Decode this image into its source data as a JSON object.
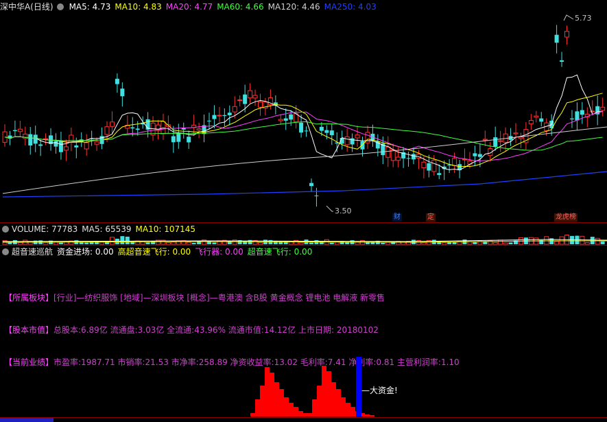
{
  "header": {
    "title": "深中华A(日线)",
    "ma": [
      {
        "label": "MA5: 4.73",
        "color": "#ffffff"
      },
      {
        "label": "MA10: 4.83",
        "color": "#ffff00"
      },
      {
        "label": "MA20: 4.77",
        "color": "#ff40ff"
      },
      {
        "label": "MA60: 4.66",
        "color": "#40ff40"
      },
      {
        "label": "MA120: 4.46",
        "color": "#d0d0d0"
      },
      {
        "label": "MA250: 4.03",
        "color": "#2040ff"
      }
    ]
  },
  "price_chart": {
    "high_label": "5.73",
    "low_label": "3.50",
    "tags": [
      {
        "text": "财",
        "color": "#4080ff",
        "bg": "#001030"
      },
      {
        "text": "定",
        "color": "#ff6060",
        "bg": "#401000"
      },
      {
        "text": "龙虎榜",
        "color": "#ff6060",
        "bg": "#401000"
      }
    ]
  },
  "volume": {
    "label": "VOLUME: 77783",
    "ma5": "MA5: 65539",
    "ma10": "MA10: 107145"
  },
  "indicator": {
    "name": "超音速巡航",
    "items": [
      {
        "label": "资金进场: 0.00",
        "color": "#ffffff"
      },
      {
        "label": "高超音速飞行: 0.00",
        "color": "#ffff00"
      },
      {
        "label": "飞行器: 0.00",
        "color": "#ff40ff"
      },
      {
        "label": "超音速飞行: 0.00",
        "color": "#40ff40"
      }
    ]
  },
  "info": {
    "sector_head": "【所属板块】",
    "sector_body": "[行业]—纺织服饰 [地域]—深圳板块 [概念]—粤港澳 含B股 黄金概念 锂电池 电解液 新零售",
    "equity_head": "【股本市值】",
    "equity_body": "总股本:6.89亿 流通盘:3.03亿 全流通:43.96% 流通市值:14.12亿 上市日期: 20180102",
    "perf_head": "【当前业绩】",
    "perf_body": "市盈率:1987.71 市销率:21.53 市净率:258.89 净资收益率:13.02 毛利率:7.41 净利率:0.81 主营利润率:1.10"
  },
  "annotation": "—大资金!"
}
